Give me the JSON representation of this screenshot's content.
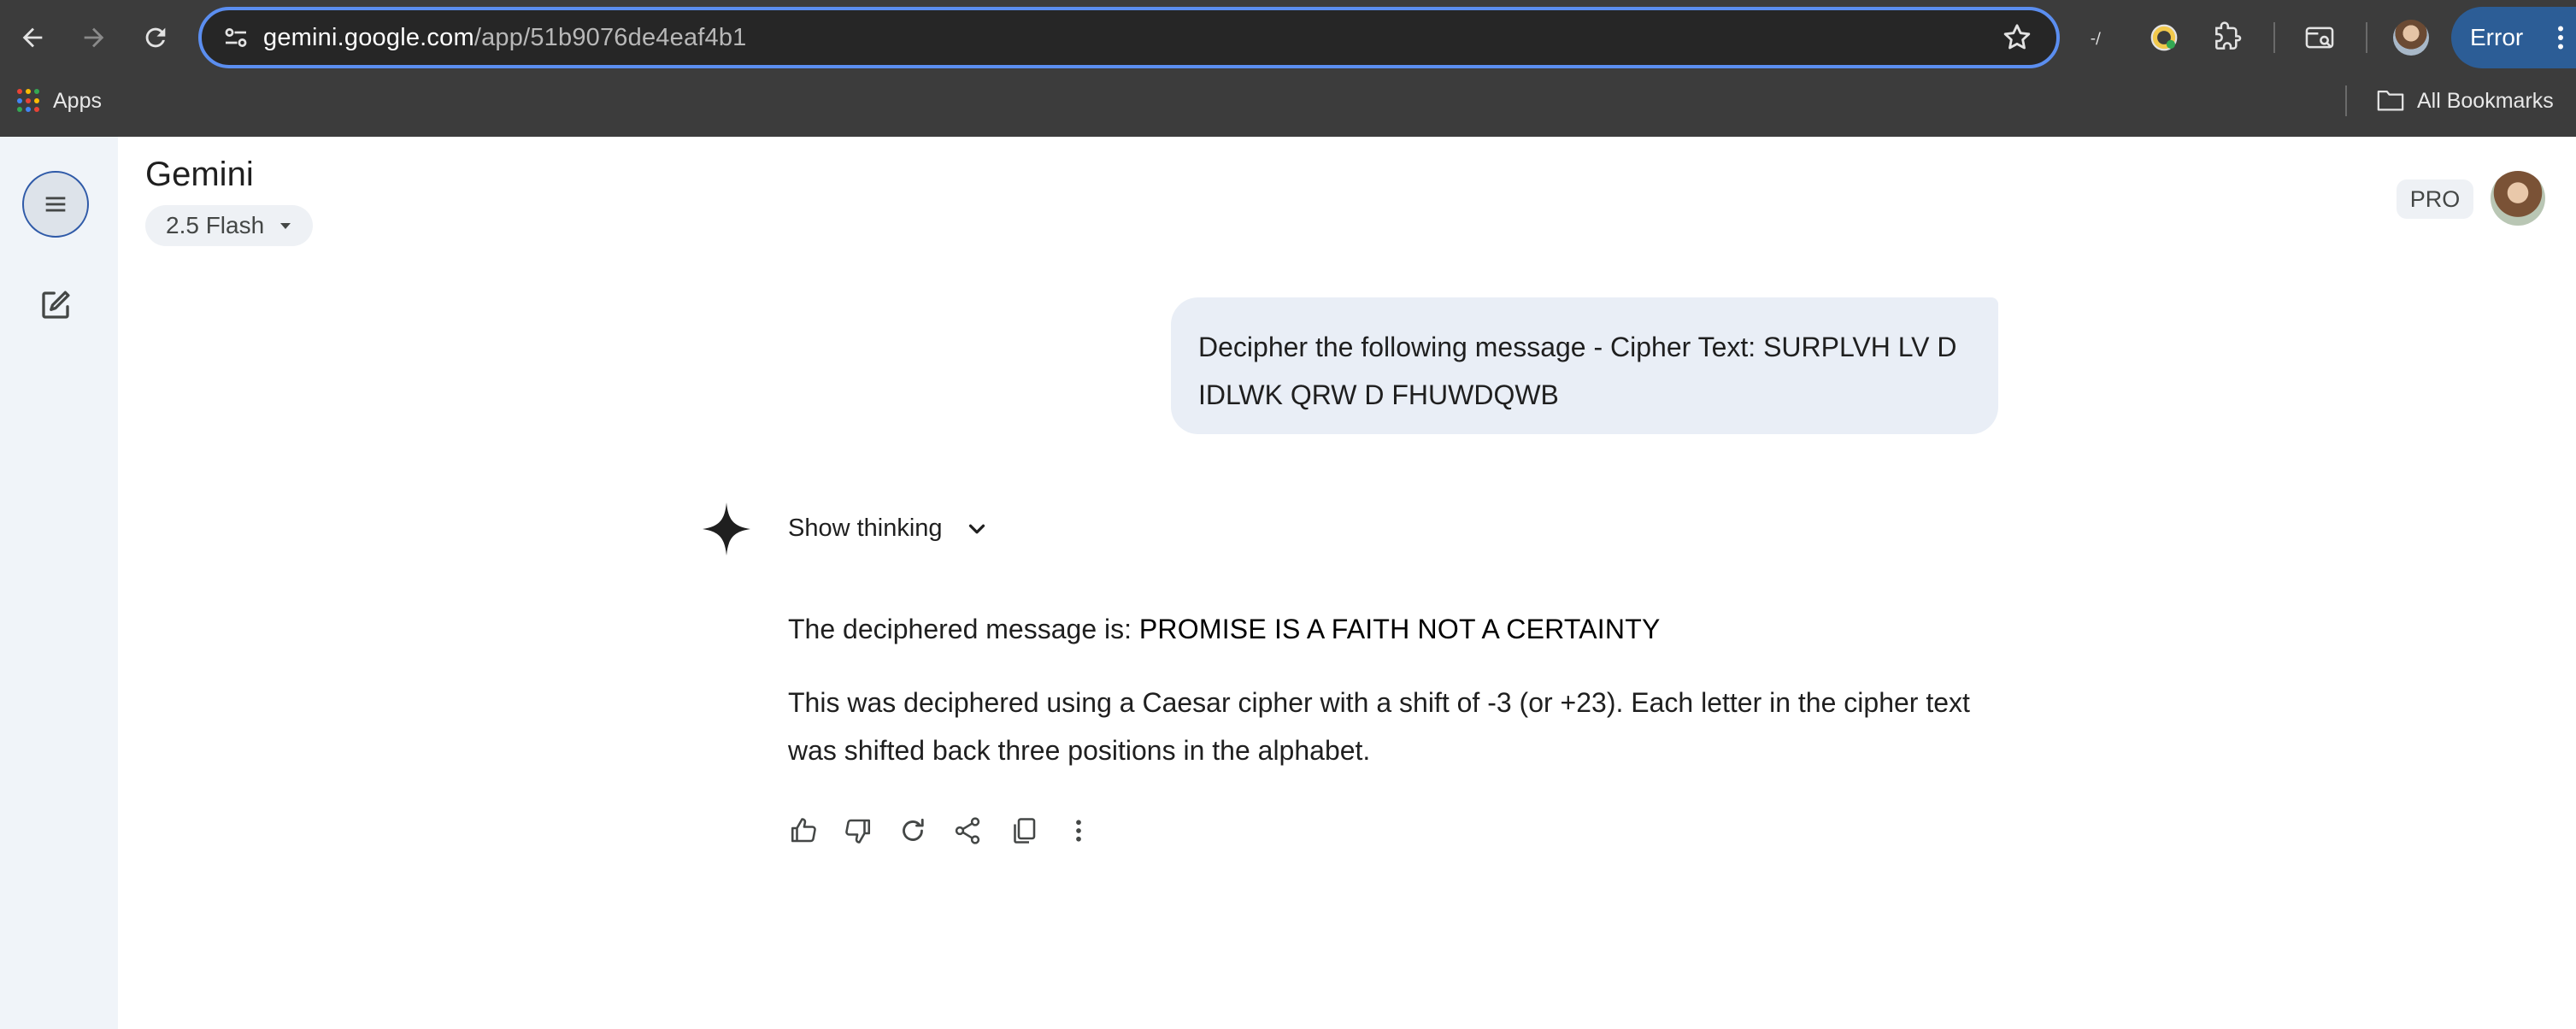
{
  "browser": {
    "url_host": "gemini.google.com",
    "url_path": "/app/51b9076de4eaf4b1",
    "profile_status": "Error",
    "bookmarks": {
      "apps_label": "Apps",
      "all_bookmarks_label": "All Bookmarks"
    },
    "colors": {
      "chrome_bg": "#3c3c3c",
      "omnibox_focus": "#5b8ef0",
      "error_pill": "#2c5d96"
    },
    "icons": [
      "back-icon",
      "forward-icon",
      "reload-icon",
      "site-info-icon",
      "bookmark-star-icon",
      "extension-icon-1",
      "extension-icon-2",
      "extensions-puzzle-icon",
      "tab-search-icon",
      "profile-avatar",
      "kebab-menu-icon",
      "apps-grid-icon",
      "folder-icon"
    ]
  },
  "app": {
    "title": "Gemini",
    "model_selector": "2.5 Flash",
    "pro_badge": "PRO",
    "colors": {
      "sidebar_bg": "#f0f4f9",
      "user_bubble_bg": "#e9eef6"
    }
  },
  "conversation": {
    "user_message": "Decipher the following message - Cipher Text: SURPLVH LV D IDLWK QRW D FHUWDQWB",
    "show_thinking_label": "Show thinking",
    "response": {
      "intro": "The deciphered message is: ",
      "answer": "PROMISE IS A FAITH NOT A CERTAINTY",
      "explanation": "This was deciphered using a Caesar cipher with a shift of -3 (or +23). Each letter in the cipher text was shifted back three positions in the alphabet."
    },
    "actions": [
      "thumbs-up-icon",
      "thumbs-down-icon",
      "regenerate-icon",
      "share-icon",
      "copy-icon",
      "more-vert-icon"
    ]
  }
}
